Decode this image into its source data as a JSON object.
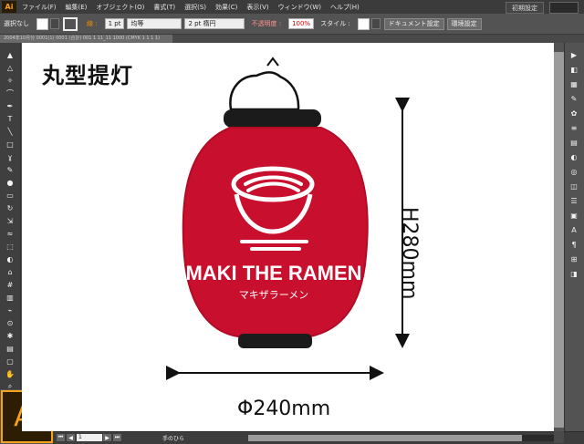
{
  "app": {
    "logo_small": "Ai",
    "logo_large": "Ai",
    "workspace": "初期設定"
  },
  "menu": [
    "ファイル(F)",
    "編集(E)",
    "オブジェクト(O)",
    "書式(T)",
    "選択(S)",
    "効果(C)",
    "表示(V)",
    "ウィンドウ(W)",
    "ヘルプ(H)"
  ],
  "control_bar": {
    "selection_label": "選択なし",
    "stroke_label": "線 :",
    "stroke_value": "1 pt",
    "stroke_profile": "均等",
    "brush_value": "2 pt 楕円",
    "opacity_label": "不透明度 :",
    "opacity_value": "100%",
    "style_label": "スタイル :",
    "document_setup": "ドキュメント設定",
    "preferences": "環境設定"
  },
  "tab": {
    "title": "2004年10月分 0001(1) 0001 (合計) 001 1 11_11 1000 (CMYK 1 1 1 1)"
  },
  "artwork": {
    "title": "丸型提灯",
    "brand": "MAKI THE RAMEN",
    "katakana": "マキザラーメン",
    "height_dim": "H280mm",
    "width_dim": "Φ240mm",
    "colors": {
      "lantern_red": "#c8102e",
      "lantern_black": "#1b1b1b",
      "canvas": "#ffffff"
    }
  },
  "status": {
    "zoom": "1",
    "tool": "手のひら"
  }
}
